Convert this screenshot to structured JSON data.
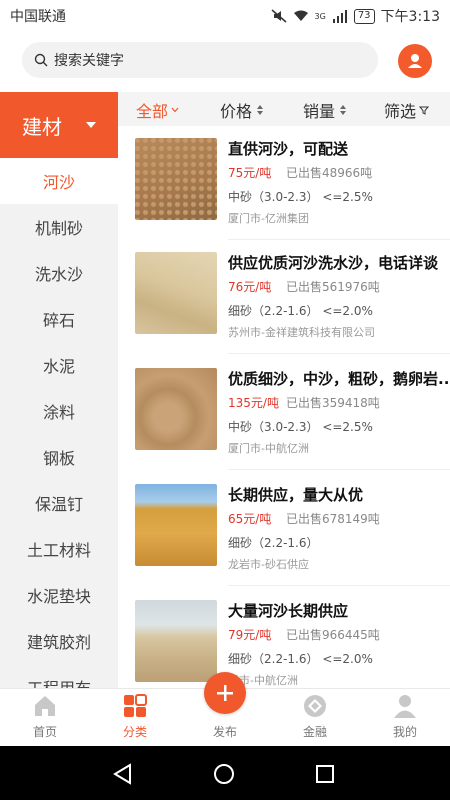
{
  "status_bar": {
    "carrier": "中国联通",
    "signal_label": "3G",
    "battery": "73",
    "time": "下午3:13"
  },
  "search": {
    "placeholder": "搜索关键字"
  },
  "category_header": {
    "label": "建材"
  },
  "categories": [
    {
      "label": "河沙",
      "active": true
    },
    {
      "label": "机制砂"
    },
    {
      "label": "洗水沙"
    },
    {
      "label": "碎石"
    },
    {
      "label": "水泥"
    },
    {
      "label": "涂料"
    },
    {
      "label": "钢板"
    },
    {
      "label": "保温钉"
    },
    {
      "label": "土工材料"
    },
    {
      "label": "水泥垫块"
    },
    {
      "label": "建筑胶剂"
    },
    {
      "label": "工程用布"
    }
  ],
  "filters": {
    "all": "全部",
    "price": "价格",
    "sales": "销量",
    "screen": "筛选"
  },
  "products": [
    {
      "title": "直供河沙，可配送",
      "price": "75元/吨",
      "sold": "已出售48966吨",
      "spec": "中砂（3.0-2.3）  <=2.5%",
      "seller": "厦门市-亿洲集团"
    },
    {
      "title": "供应优质河沙洗水沙，电话详谈",
      "price": "76元/吨",
      "sold": "已出售561976吨",
      "spec": "细砂（2.2-1.6）  <=2.0%",
      "seller": "苏州市-金祥建筑科技有限公司"
    },
    {
      "title": "优质细沙，中沙，粗砂，鹅卵岩...",
      "price": "135元/吨",
      "sold": "已出售359418吨",
      "spec": "中砂（3.0-2.3）  <=2.5%",
      "seller": "厦门市-中航亿洲"
    },
    {
      "title": "长期供应，量大从优",
      "price": "65元/吨",
      "sold": "已出售678149吨",
      "spec": "细砂（2.2-1.6）",
      "seller": "龙岩市-砂石供应"
    },
    {
      "title": "大量河沙长期供应",
      "price": "79元/吨",
      "sold": "已出售966445吨",
      "spec": "细砂（2.2-1.6）  <=2.0%",
      "seller": "界市-中航亿洲"
    }
  ],
  "tabs": {
    "home": "首页",
    "category": "分类",
    "publish": "发布",
    "finance": "金融",
    "mine": "我的"
  },
  "colors": {
    "accent": "#f1582c",
    "price": "#e0362b"
  }
}
